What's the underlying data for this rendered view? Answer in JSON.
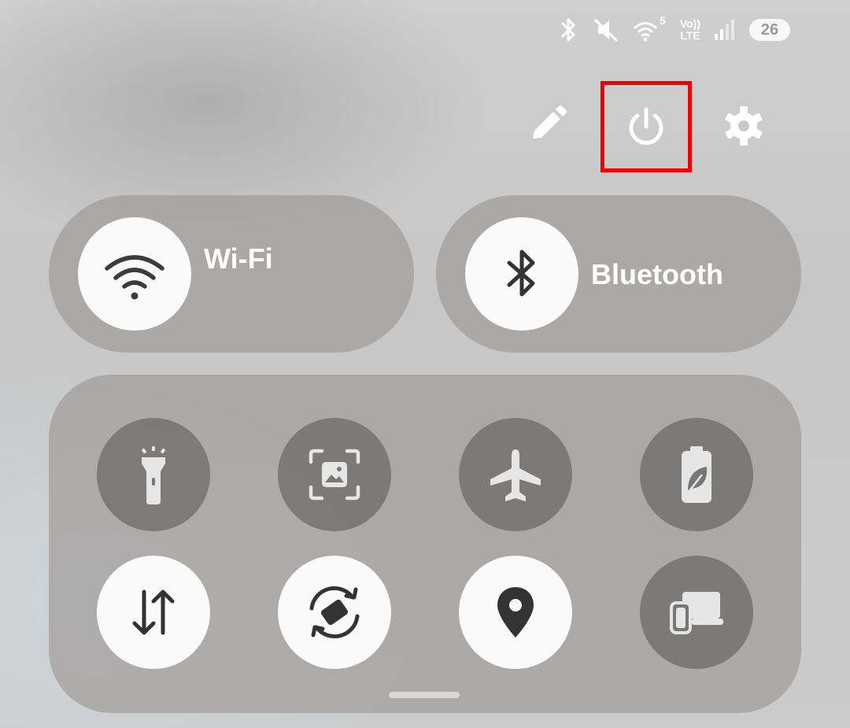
{
  "status_bar": {
    "wifi_generation": "5",
    "volte_top": "Vo))",
    "volte_bottom": "LTE",
    "battery_level": "26"
  },
  "top_actions": {
    "edit": "pencil-icon",
    "power": "power-icon",
    "settings": "gear-icon",
    "highlight_color": "#ee0000"
  },
  "tiles": {
    "wifi": {
      "label": "Wi-Fi",
      "state": "on"
    },
    "bluetooth": {
      "label": "Bluetooth",
      "state": "on"
    }
  },
  "toggles": [
    {
      "icon": "flashlight-icon",
      "state": "off"
    },
    {
      "icon": "scan-icon",
      "state": "off"
    },
    {
      "icon": "airplane-icon",
      "state": "off"
    },
    {
      "icon": "battery-saver-icon",
      "state": "off"
    },
    {
      "icon": "mobile-data-icon",
      "state": "on"
    },
    {
      "icon": "auto-rotate-icon",
      "state": "on"
    },
    {
      "icon": "location-icon",
      "state": "on"
    },
    {
      "icon": "cast-devices-icon",
      "state": "off"
    }
  ]
}
